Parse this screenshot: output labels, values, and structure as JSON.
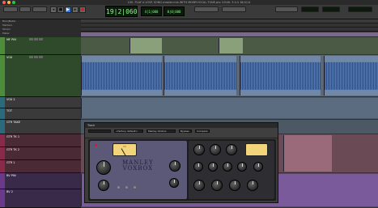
{
  "window": {
    "title": "100. PLAY A LOVE SONG.master.mix.WITH MIXBY.VOCAL.TUNE.ptx 3.Edit: 3.V.4 18/4/14",
    "traffic": [
      "#ff5f57",
      "#ffbd2e",
      "#28c940"
    ]
  },
  "counter": {
    "main": "19|2|060",
    "sub1": "4|1|000",
    "sub2": "0|0|000"
  },
  "rulers": [
    "Bars|Beats",
    "Markers",
    "Tempo",
    "Meter",
    "Chords"
  ],
  "tracks": [
    {
      "name": "MF PIN",
      "color": "#4c8c3a"
    },
    {
      "name": "VOX",
      "color": "#4c8c3a"
    },
    {
      "name": "VOX 2",
      "color": "#2a6a7a"
    },
    {
      "name": "TOT",
      "color": "#2a6a7a"
    },
    {
      "name": "GTR TAKE",
      "color": "#2a6a7a"
    },
    {
      "name": "GTR TK 1",
      "color": "#8a2a4a"
    },
    {
      "name": "GTR TK 2",
      "color": "#8a2a4a"
    },
    {
      "name": "GTR 1",
      "color": "#8a2a4a"
    },
    {
      "name": "BV PIN",
      "color": "#6a3a8a"
    },
    {
      "name": "BV 2",
      "color": "#6a3a8a"
    }
  ],
  "plugin": {
    "title": "Track",
    "preset": "<factory default>",
    "insert": "Manley Voxbox",
    "brand_line1": "MANLEY",
    "brand_line2": "VOXBOX",
    "vu_label": "VU",
    "bypass": "Bypass",
    "compare": "Compare"
  },
  "colors": {
    "clip": "#6f88a8",
    "marker": "#7a6a8a"
  }
}
